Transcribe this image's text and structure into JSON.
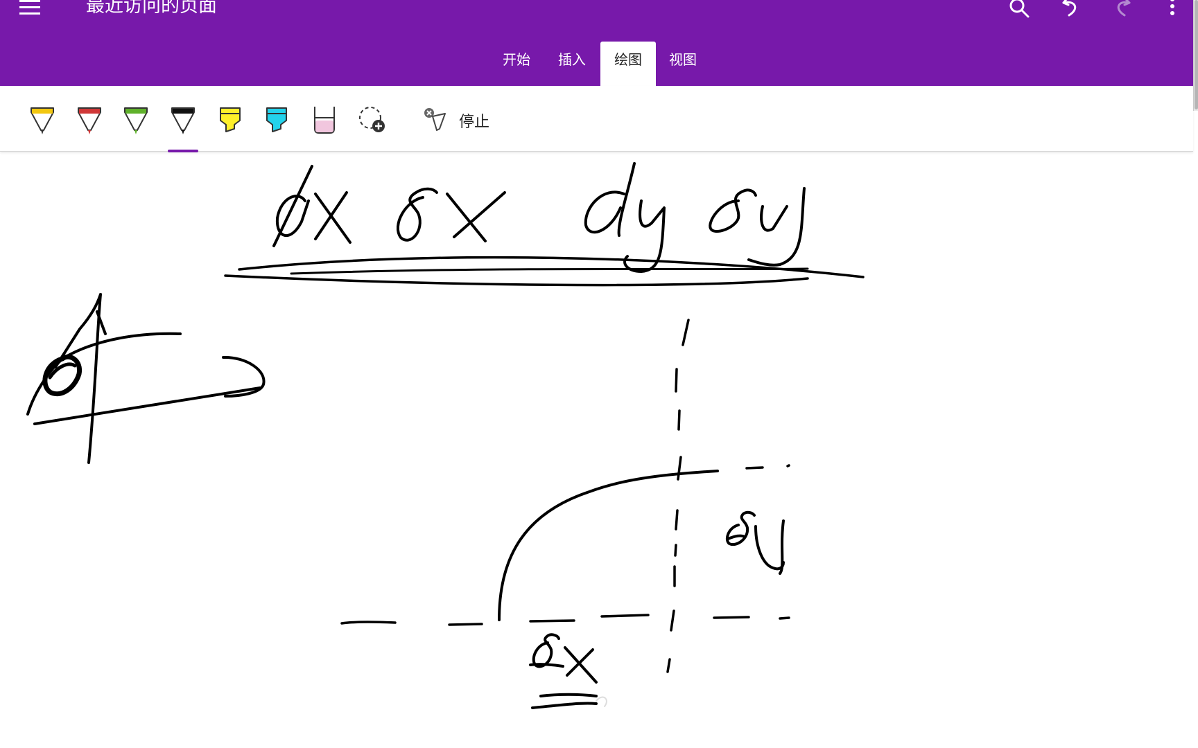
{
  "header": {
    "title": "最近访问的页面",
    "icons": [
      "menu-icon",
      "search-icon",
      "undo-icon",
      "redo-icon",
      "more-vertical-icon"
    ],
    "accent_color": "#7719aa"
  },
  "tabs": [
    {
      "label": "开始",
      "active": false
    },
    {
      "label": "插入",
      "active": false
    },
    {
      "label": "绘图",
      "active": true
    },
    {
      "label": "视图",
      "active": false
    }
  ],
  "ribbon": {
    "tools": [
      {
        "name": "pen-yellow",
        "color": "#f2c70f"
      },
      {
        "name": "pen-red",
        "color": "#d03838"
      },
      {
        "name": "pen-green",
        "color": "#5fb12b"
      },
      {
        "name": "pen-black",
        "color": "#111111",
        "selected": true
      },
      {
        "name": "highlighter-yellow",
        "color": "#fff02a"
      },
      {
        "name": "highlighter-cyan",
        "color": "#23d3ec"
      },
      {
        "name": "highlighter-pink",
        "color": "#f1c6de"
      },
      {
        "name": "add-pen",
        "color": "#444444"
      }
    ],
    "stop_label": "停止"
  }
}
